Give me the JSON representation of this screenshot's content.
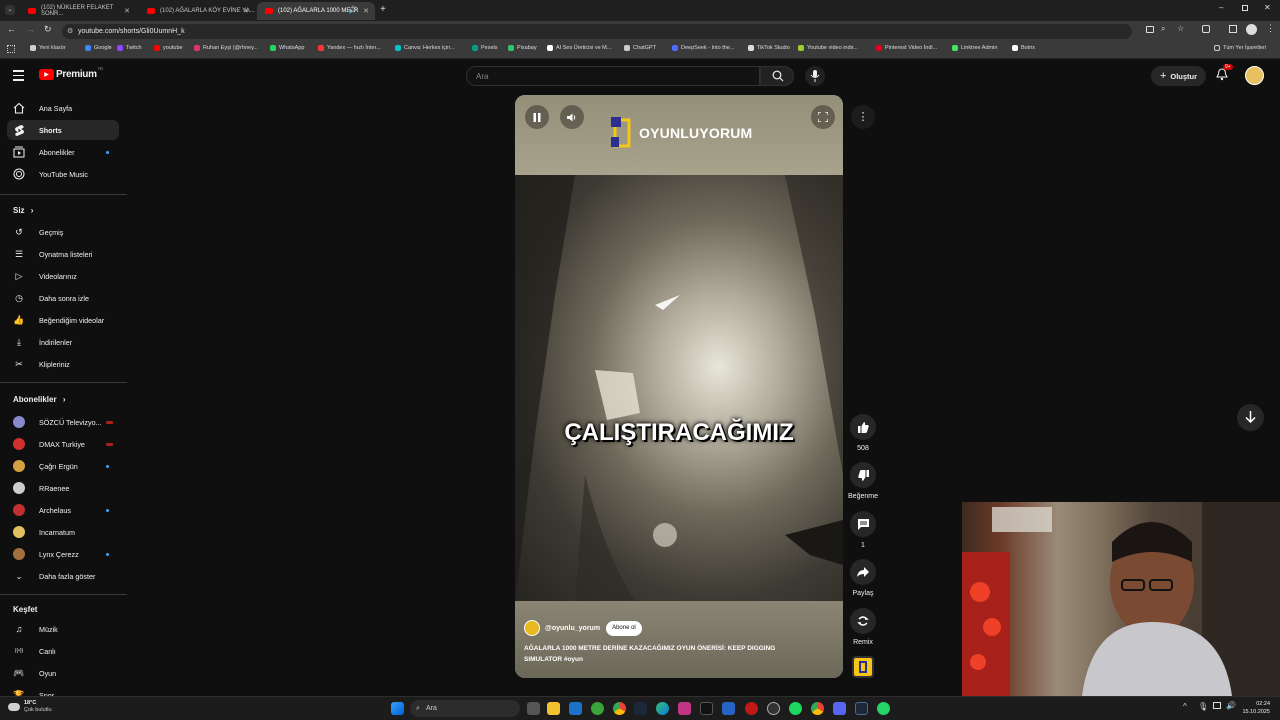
{
  "browser": {
    "tabs": [
      {
        "title": "(102) NÜKLEER FELAKET SONR...",
        "active": false
      },
      {
        "title": "(102) AĞALARLA KÖY EVİNE YA...",
        "active": false
      },
      {
        "title": "(102) AĞALARLA 1000 METR",
        "active": true
      }
    ],
    "url": "youtube.com/shorts/Gli0UumnH_k",
    "bookmarks": [
      {
        "label": "Yeni klasör",
        "color": "#cfcfcf"
      },
      {
        "label": "Google",
        "color": "#4285f4"
      },
      {
        "label": "Twitch",
        "color": "#9146ff"
      },
      {
        "label": "youtube",
        "color": "#ff0000"
      },
      {
        "label": "Ruhan Eyşi (@rhney...",
        "color": "#e1306c"
      },
      {
        "label": "WhatsApp",
        "color": "#25d366"
      },
      {
        "label": "Yandex — hızlı İnter...",
        "color": "#ff3333"
      },
      {
        "label": "Canva: Herkes için...",
        "color": "#00c4cc"
      },
      {
        "label": "Pexels",
        "color": "#05a081"
      },
      {
        "label": "Pixabay",
        "color": "#2ec66d"
      },
      {
        "label": "AI Ses Üreticisi ve M...",
        "color": "#ffffff"
      },
      {
        "label": "ChatGPT",
        "color": "#cccccc"
      },
      {
        "label": "DeepSeek - Into the...",
        "color": "#4d6bfe"
      },
      {
        "label": "TikTok Studio",
        "color": "#dddddd"
      },
      {
        "label": "Youtube video indir...",
        "color": "#9acd32"
      },
      {
        "label": "Pinterest Video İndi...",
        "color": "#e60023"
      },
      {
        "label": "Linktree Admin",
        "color": "#43e660"
      },
      {
        "label": "Botrix",
        "color": "#ffffff"
      }
    ],
    "all_bookmarks": "Tüm Yer İşaretleri"
  },
  "youtube": {
    "logo_text": "Premium",
    "logo_tm": "TR",
    "search_placeholder": "Ara",
    "create_label": "Oluştur",
    "notif_count": "9+",
    "sidebar": {
      "main": [
        {
          "label": "Ana Sayfa",
          "icon": "home-icon"
        },
        {
          "label": "Shorts",
          "icon": "shorts-icon",
          "active": true
        },
        {
          "label": "Abonelikler",
          "icon": "subscriptions-icon",
          "dot": true
        },
        {
          "label": "YouTube Music",
          "icon": "youtube-music-icon"
        }
      ],
      "you_header": "Siz",
      "you": [
        {
          "label": "Geçmiş",
          "icon": "history-icon"
        },
        {
          "label": "Oynatma listeleri",
          "icon": "playlists-icon"
        },
        {
          "label": "Videolarınız",
          "icon": "your-videos-icon"
        },
        {
          "label": "Daha sonra izle",
          "icon": "watch-later-icon"
        },
        {
          "label": "Beğendiğim videolar",
          "icon": "liked-videos-icon"
        },
        {
          "label": "İndirilenler",
          "icon": "downloads-icon"
        },
        {
          "label": "Klipleriniz",
          "icon": "clips-icon"
        }
      ],
      "subs_header": "Abonelikler",
      "subs": [
        {
          "label": "SÖZCÜ Televizyo...",
          "color": "#8888cc",
          "status": "live"
        },
        {
          "label": "DMAX Turkiye",
          "color": "#d03030",
          "status": "live"
        },
        {
          "label": "Çağrı Ergün",
          "color": "#d4a040",
          "status": "dot"
        },
        {
          "label": "RRaenee",
          "color": "#cccccc",
          "status": ""
        },
        {
          "label": "Archelaus",
          "color": "#c03030",
          "status": "dot"
        },
        {
          "label": "Incarnatum",
          "color": "#e0c060",
          "status": ""
        },
        {
          "label": "Lynx Çerezz",
          "color": "#a07040",
          "status": "dot"
        }
      ],
      "show_more": "Daha fazla göster",
      "explore_header": "Keşfet",
      "explore": [
        {
          "label": "Müzik",
          "icon": "music-icon"
        },
        {
          "label": "Canlı",
          "icon": "live-icon"
        },
        {
          "label": "Oyun",
          "icon": "gaming-icon"
        },
        {
          "label": "Spor",
          "icon": "sports-icon"
        }
      ]
    },
    "short": {
      "brand": "OYUNLUYORUM",
      "caption": "ÇALIŞTIRACAĞIMIZ",
      "channel": "@oyunlu_yorum",
      "subscribe_label": "Abone ol",
      "title": "AĞALARLA 1000 METRE DERİNE KAZACAĞIMIZ OYUN ÖNERİSİ: KEEP DIGGING SIMULATOR #oyun",
      "likes": "508",
      "dislike_label": "Beğenme",
      "comments": "1",
      "share_label": "Paylaş",
      "remix_label": "Remix"
    }
  },
  "taskbar": {
    "weather_temp": "18°C",
    "weather_desc": "Çok bulutlu",
    "search_label": "Ara",
    "time": "02:24",
    "date": "15.10.2025"
  }
}
